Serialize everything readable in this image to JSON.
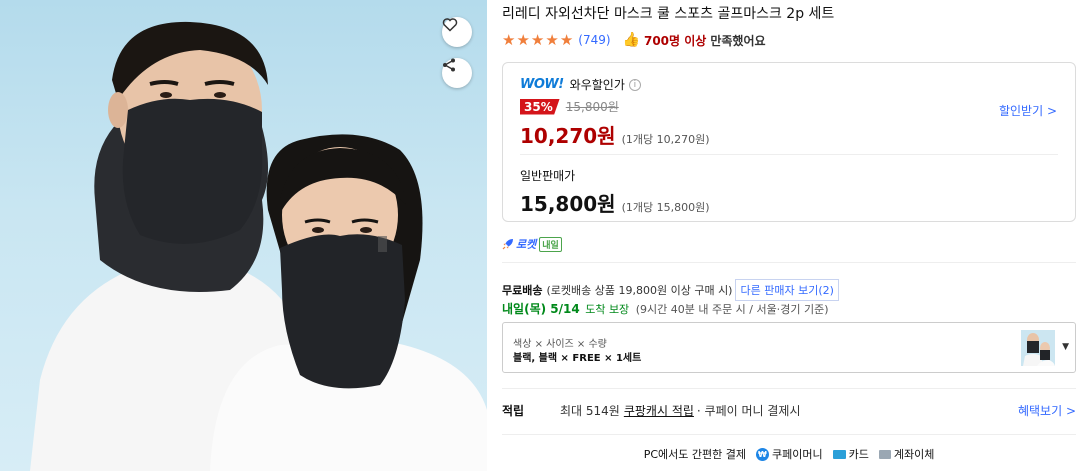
{
  "product": {
    "title": "리레디 자외선차단 마스크 쿨 스포츠 골프마스크 2p 세트",
    "image_alt": "블랙 쿨 마스크를 착용한 남녀 모델"
  },
  "actions": {
    "wishlist_icon": "heart-icon",
    "share_icon": "share-icon"
  },
  "rating": {
    "stars": 5,
    "review_count": "(749)",
    "satisfied_count": "700명 이상",
    "satisfied_text": "만족했어요"
  },
  "wow": {
    "logo": "WOW!",
    "label": "와우할인가",
    "discount": "35%",
    "original_price": "15,800원",
    "sale_price": "10,270원",
    "unit_price": "(1개당 10,270원)",
    "coupon_link": "할인받기 >"
  },
  "normal": {
    "label": "일반판매가",
    "price": "15,800원",
    "unit_price": "(1개당 15,800원)"
  },
  "rocket": {
    "label": "로켓",
    "badge": "내일"
  },
  "shipping": {
    "free": "무료배송",
    "desc": "(로켓배송 상품 19,800원 이상 구매 시)",
    "other_sellers": "다른 판매자 보기(2)",
    "arrival_date": "내일(목) 5/14",
    "arrival_guarantee": "도착 보장",
    "arrival_condition": "(9시간 40분 내 주문 시 / 서울⋅경기 기준)"
  },
  "option": {
    "label": "색상 × 사이즈 × 수량",
    "value": "블랙, 블랙 × FREE × 1세트"
  },
  "points": {
    "label": "적립",
    "max": "최대 514원",
    "cash": "쿠팡캐시 적립",
    "pay": "· 쿠페이 머니 결제시",
    "benefit_link": "혜택보기 >"
  },
  "payment": {
    "intro": "PC에서도 간편한 결제",
    "coupay": "쿠페이머니",
    "card": "카드",
    "bank": "계좌이체"
  },
  "colors": {
    "accent_blue": "#346aff",
    "price_red": "#ae0000",
    "discount_red": "#d4141a",
    "star_orange": "#f07f3c",
    "arrival_green": "#00891a"
  }
}
